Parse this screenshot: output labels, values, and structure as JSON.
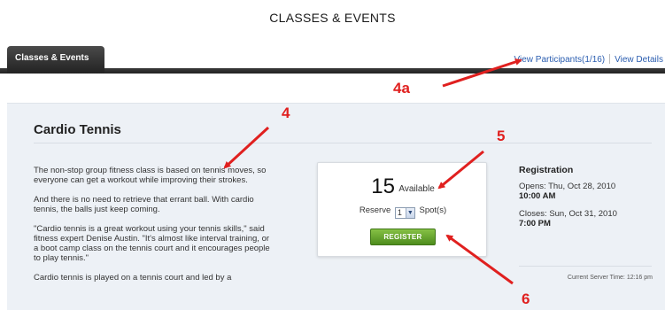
{
  "page": {
    "title": "CLASSES & EVENTS"
  },
  "tabs": {
    "active_label": "Classes & Events"
  },
  "top_links": {
    "view_participants": "View Participants(1/16)",
    "view_details": "View Details"
  },
  "class": {
    "title": "Cardio Tennis",
    "description": [
      "The non-stop group fitness class is based on tennis moves, so everyone can get a workout while improving their strokes.",
      "And there is no need to retrieve that errant ball. With cardio tennis, the balls just keep coming.",
      "\"Cardio tennis is a great workout using your tennis skills,\" said fitness expert Denise Austin. \"It's almost like interval training, or a boot camp class on the tennis court and it encourages people to play tennis.\"",
      "Cardio tennis is played on a tennis court and led by a"
    ]
  },
  "registration_box": {
    "spots_count": "15",
    "spots_label": "Available",
    "reserve_label": "Reserve",
    "reserve_value": "1",
    "spots_suffix": "Spot(s)",
    "register_label": "REGISTER"
  },
  "registration_info": {
    "heading": "Registration",
    "opens_label": "Opens: Thu, Oct 28, 2010",
    "opens_time": "10:00 AM",
    "closes_label": "Closes: Sun, Oct 31, 2010",
    "closes_time": "7:00 PM"
  },
  "server_time": "Current Server Time: 12:16 pm",
  "annotations": {
    "label_4a": "4a",
    "label_4": "4",
    "label_5": "5",
    "label_6": "6",
    "arrow_color": "#e0201f"
  },
  "colors": {
    "link": "#2a5db0",
    "tab_bar": "#222222",
    "panel_bg": "#edf1f6",
    "register_green": "#5a9a26"
  }
}
